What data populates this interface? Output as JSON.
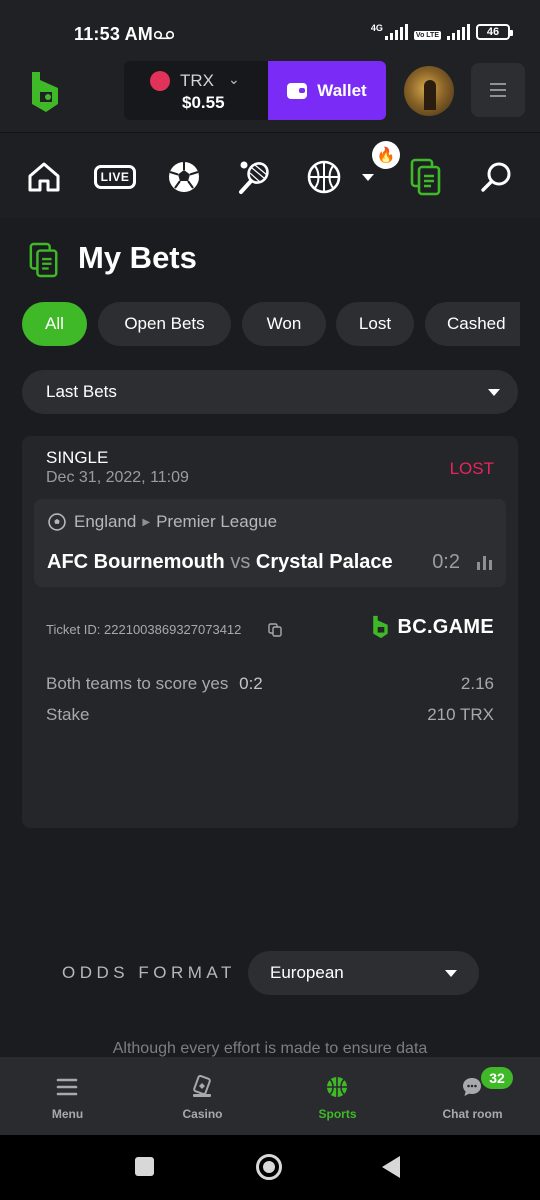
{
  "status_bar": {
    "time": "11:53 AM",
    "network": "4G",
    "volte": "Vo LTE",
    "battery": "46"
  },
  "header": {
    "currency": {
      "name": "TRX",
      "balance": "$0.55",
      "coin_color": "#e3325a"
    },
    "wallet_label": "Wallet",
    "brand_color": "#7a2cf6"
  },
  "category_nav": {
    "items": [
      "home-icon",
      "live-icon",
      "soccer-icon",
      "tennis-icon",
      "basketball-icon",
      "more-icon",
      "bets-icon",
      "search-icon"
    ],
    "live_label": "LIVE",
    "hot_icon": "fire-icon"
  },
  "page": {
    "title": "My Bets"
  },
  "filters": {
    "chips": [
      "All",
      "Open Bets",
      "Won",
      "Lost",
      "Cashed"
    ],
    "active": "All"
  },
  "history_select": {
    "value": "Last Bets"
  },
  "bet": {
    "type": "SINGLE",
    "date": "Dec 31, 2022, 11:09",
    "status": "LOST",
    "status_color": "#e8245c",
    "country": "England",
    "league": "Premier League",
    "home_team": "AFC Bournemouth",
    "vs": "vs",
    "away_team": "Crystal Palace",
    "score": "0:2",
    "ticket_id": "Ticket ID: 2221003869327073412",
    "brand_logo": "BC.GAME",
    "selection_label": "Both teams to score yes",
    "selection_score": "0:2",
    "odds": "2.16",
    "stake_label": "Stake",
    "stake_value": "210 TRX"
  },
  "odds_format": {
    "label": "ODDS FORMAT",
    "value": "European"
  },
  "disclaimer": "Although every effort is made to ensure data",
  "tabbar": {
    "menu": "Menu",
    "casino": "Casino",
    "sports": "Sports",
    "chat": "Chat room",
    "chat_badge": "32",
    "accent": "#3fb928"
  }
}
